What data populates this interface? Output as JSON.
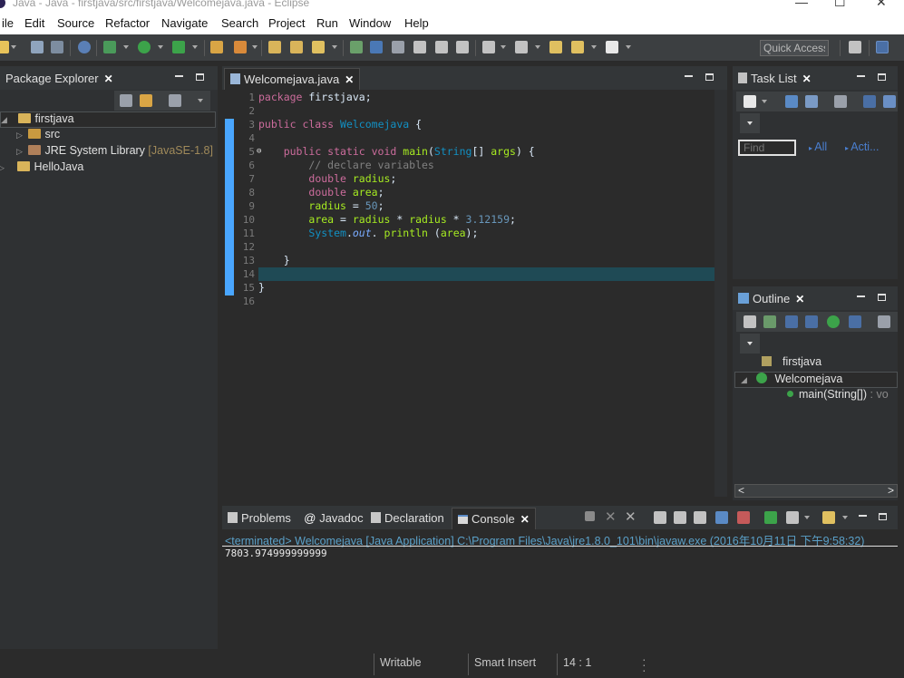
{
  "window": {
    "title": "Java - Java - firstjava/src/firstjava/Welcomejava.java - Eclipse",
    "controls": [
      "—",
      "☐",
      "✕"
    ]
  },
  "menu": [
    "ile",
    "Edit",
    "Source",
    "Refactor",
    "Navigate",
    "Search",
    "Project",
    "Run",
    "Window",
    "Help"
  ],
  "toolbar": {
    "quick_access": "Quick Access"
  },
  "package_explorer": {
    "title": "Package Explorer",
    "close": "✕",
    "tree": [
      {
        "label": "firstjava",
        "toggle": "◢",
        "icon": "project-folder-icon"
      },
      {
        "label": "src",
        "toggle": "▷",
        "icon": "src-folder-icon"
      },
      {
        "label": "JRE System Library",
        "decoration": "[JavaSE-1.8]",
        "toggle": "▷",
        "icon": "library-icon"
      },
      {
        "label": "HelloJava",
        "toggle": "▷",
        "icon": "project-folder-icon"
      }
    ]
  },
  "editor": {
    "tab_label": "Welcomejava.java",
    "close": "✕",
    "line_numbers": [
      "1",
      "2",
      "3",
      "4",
      "5",
      "6",
      "7",
      "8",
      "9",
      "10",
      "11",
      "12",
      "13",
      "14",
      "15",
      "16"
    ],
    "fold_marker": "⊖",
    "code": {
      "l1_kw": "package",
      "l1_rest": " firstjava;",
      "l3_kw": "public class",
      "l3_cls": "Welcomejava",
      "l3_rest": " {",
      "l5_indent": "    ",
      "l5_kw": "public static void",
      "l5_fn": "main",
      "l5_p1": "(",
      "l5_ty": "String",
      "l5_p2": "[] ",
      "l5_arg": "args",
      "l5_p3": ") {",
      "l6": "        // declare variables",
      "l7_indent": "        ",
      "l7_kw": "double",
      "l7_var": "radius",
      "l7_end": ";",
      "l8_indent": "        ",
      "l8_kw": "double",
      "l8_var": "area",
      "l8_end": ";",
      "l9_indent": "        ",
      "l9_a": "radius",
      "l9_b": " = ",
      "l9_num": "50",
      "l9_end": ";",
      "l10_indent": "        ",
      "l10_a": "area",
      "l10_b": " = ",
      "l10_c": "radius",
      "l10_d": " * ",
      "l10_e": "radius",
      "l10_f": " * ",
      "l10_num": "3.12159",
      "l10_end": ";",
      "l11_indent": "        ",
      "l11_sys": "System",
      "l11_dot": ".",
      "l11_out": "out",
      "l11_dot2": ". ",
      "l11_fn": "println",
      "l11_p": " (",
      "l11_arg": "area",
      "l11_end": ");",
      "l13": "    }",
      "l15": "}"
    }
  },
  "task_list": {
    "title": "Task List",
    "close": "✕",
    "find_placeholder": "Find",
    "all_label": "All",
    "activate_label": "Acti..."
  },
  "outline": {
    "title": "Outline",
    "close": "✕",
    "items": [
      {
        "label": "firstjava",
        "icon": "package-icon"
      },
      {
        "label": "Welcomejava",
        "icon": "class-icon",
        "toggle": "◢"
      },
      {
        "label": "main(String[])",
        "suffix": " : vo",
        "icon": "method-icon"
      }
    ],
    "scroll_left": "<",
    "scroll_right": ">"
  },
  "bottom_tabs": {
    "problems": "Problems",
    "javadoc": "Javadoc",
    "declaration": "Declaration",
    "console": "Console",
    "close": "✕"
  },
  "console": {
    "header": "<terminated> Welcomejava [Java Application] C:\\Program Files\\Java\\jre1.8.0_101\\bin\\javaw.exe (2016年10月11日 下午9:58:32)",
    "output": "7803.974999999999"
  },
  "statusbar": {
    "writable": "Writable",
    "insert_mode": "Smart Insert",
    "position": "14 : 1"
  }
}
